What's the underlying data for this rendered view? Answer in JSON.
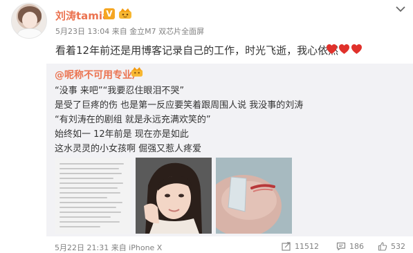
{
  "post": {
    "username": "刘涛tamia",
    "verified_badge": "V",
    "meta": "5月23日 13:04 来自 金立M7 双芯片全面屏",
    "text": "看着12年前还是用博客记录自己的工作，时光飞逝，我心依然",
    "heart_icons": [
      "heart-icon",
      "heart-icon",
      "heart-icon"
    ],
    "menu_icon": "chevron-down-icon"
  },
  "repost": {
    "username": "@呢称不可用专业户",
    "lines": [
      "“没事 来吧”“我要忍住眼泪不哭”",
      "是受了巨疼的伤 也是第一反应要笑着跟周围人说 我没事的刘涛",
      "“有刘涛在的剧组 就是永远充满欢笑的”",
      "始终如一 12年前是 现在亦是如此",
      "这水灵灵的小女孩啊 倔强又惹人疼爱"
    ],
    "meta": "5月22日 21:31 来自 iPhone X",
    "stats": {
      "forward": "11512",
      "comment": "186",
      "like": "532"
    }
  },
  "colors": {
    "username": "#eb7350",
    "meta": "#808080",
    "repost_bg": "#f2f2f5",
    "heart": "#e0312b"
  }
}
